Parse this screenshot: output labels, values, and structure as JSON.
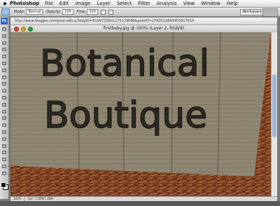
{
  "menubar": {
    "app_name": "Photoshop",
    "items": [
      "File",
      "Edit",
      "Image",
      "Layer",
      "Select",
      "Filter",
      "Analysis",
      "View",
      "Window",
      "Help"
    ]
  },
  "options_bar": {
    "mode_label": "Mode:",
    "mode_value": "Normal",
    "opacity_label": "Opacity:",
    "opacity_value": "100",
    "flow_label": "Flow:",
    "flow_value": "100",
    "workspace_label": "Workspace"
  },
  "toolbox": {
    "logo": "Ps",
    "tools": [
      "move-tool-icon",
      "marquee-tool-icon",
      "lasso-tool-icon",
      "magic-wand-icon",
      "crop-tool-icon",
      "slice-tool-icon",
      "healing-brush-icon",
      "brush-tool-icon",
      "clone-stamp-icon",
      "history-brush-icon",
      "eraser-tool-icon",
      "gradient-tool-icon",
      "blur-tool-icon",
      "dodge-tool-icon",
      "pen-tool-icon",
      "type-tool-icon",
      "path-selection-icon",
      "shape-tool-icon",
      "notes-tool-icon",
      "eyedropper-icon",
      "hand-tool-icon",
      "zoom-tool-icon"
    ]
  },
  "document": {
    "url": "http://www.blogger.com/post-edit.g?blogID=8199753601275179088&postID=2783012845955817414",
    "title": "firstbaby.jpg @ 300% (Layer 2, RGB/8)"
  },
  "canvas": {
    "sign_line1": "Botanical",
    "sign_line2": "Boutique"
  },
  "statusbar": {
    "zoom": "300%",
    "doc_info": "Doc: 1.08M/1.08M"
  },
  "colors": {
    "selected_tool": "#9fc0e6",
    "traffic_close": "#e0443e",
    "traffic_min": "#dea123",
    "traffic_max": "#2aa13a",
    "wood": "#8d8571",
    "mulch": "#7b3f22"
  }
}
